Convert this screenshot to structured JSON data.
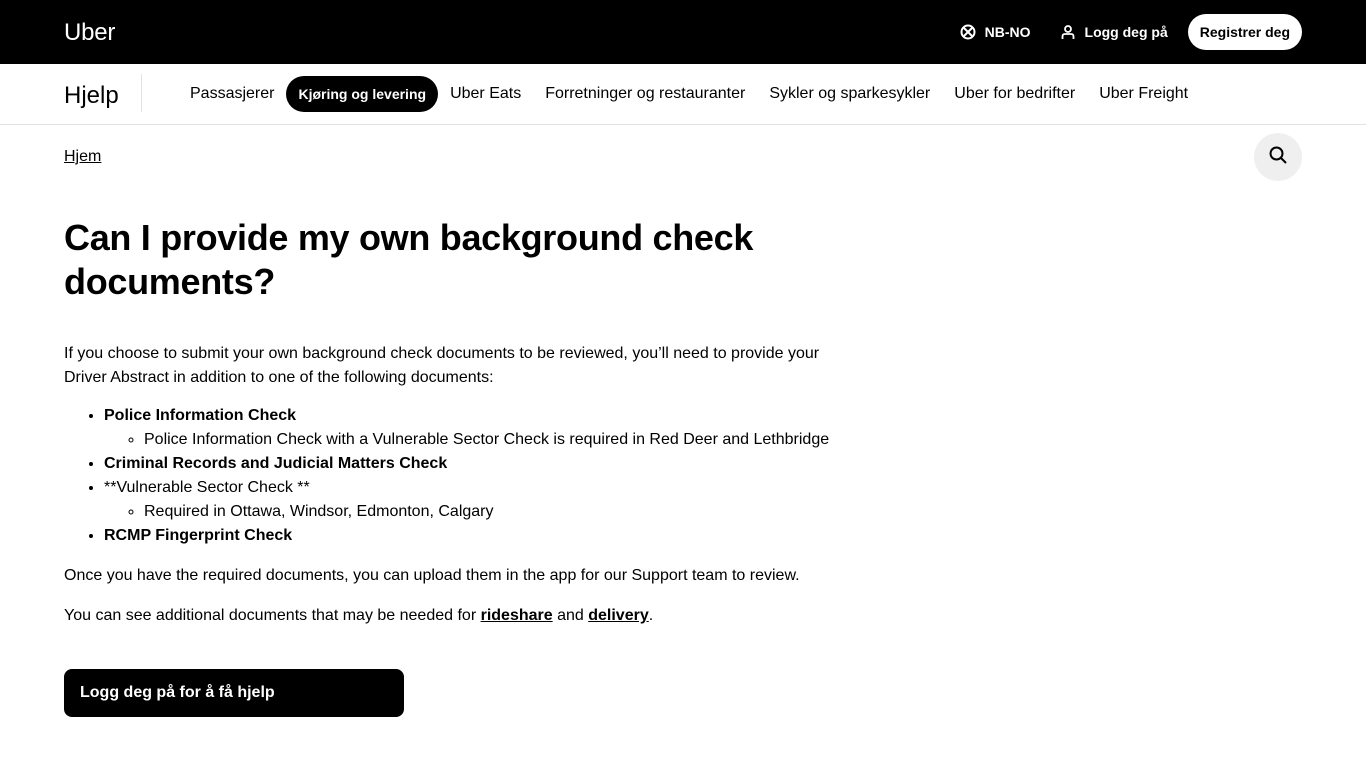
{
  "header": {
    "brand": "Uber",
    "language": "NB-NO",
    "login": "Logg deg på",
    "register": "Registrer deg"
  },
  "subnav": {
    "title": "Hjelp",
    "items": [
      {
        "label": "Passasjerer"
      },
      {
        "label": "Kjøring og levering"
      },
      {
        "label": "Uber Eats"
      },
      {
        "label": "Forretninger og restauranter"
      },
      {
        "label": "Sykler og sparkesykler"
      },
      {
        "label": "Uber for bedrifter"
      },
      {
        "label": "Uber Freight"
      }
    ],
    "active_index": 1
  },
  "breadcrumb": {
    "home": "Hjem"
  },
  "article": {
    "title": "Can I provide my own background check documents?",
    "intro": "If you choose to submit your own background check documents to be reviewed, you’ll need to provide your Driver Abstract in addition to one of the following documents:",
    "list": {
      "item1": "Police Information Check",
      "item1_sub": "Police Information Check with a Vulnerable Sector Check is required in Red Deer and Lethbridge",
      "item2": "Criminal Records and Judicial Matters Check",
      "item3": "**Vulnerable Sector Check **",
      "item3_sub": "Required in Ottawa, Windsor, Edmonton, Calgary",
      "item4": "RCMP Fingerprint Check"
    },
    "para2": "Once you have the required documents, you can upload them in the app for our Support team to review.",
    "para3_prefix": "You can see additional documents that may be needed for ",
    "para3_link1": "rideshare",
    "para3_mid": " and ",
    "para3_link2": "delivery",
    "para3_suffix": "."
  },
  "cta": {
    "label": "Logg deg på for å få hjelp"
  },
  "icons": {
    "language": "globe-icon",
    "login": "person-icon",
    "search": "search-icon"
  },
  "colors": {
    "topbar": "#000000",
    "search_bg": "#efefef",
    "divider": "#e2e2e2"
  }
}
